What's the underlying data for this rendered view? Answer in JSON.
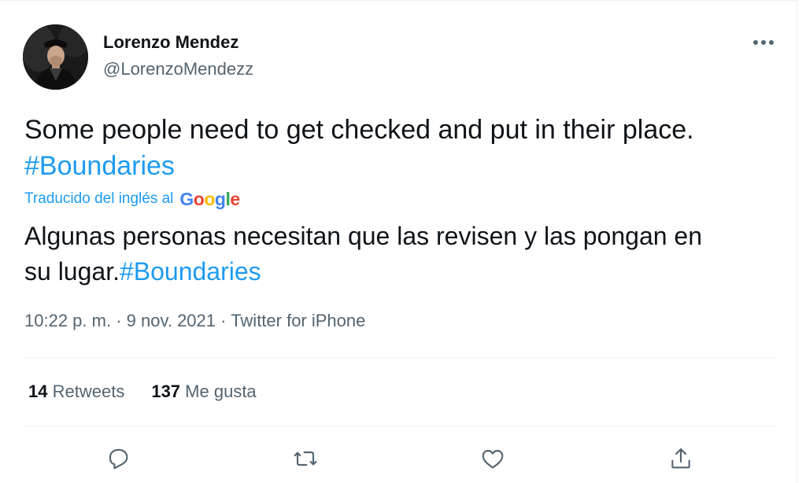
{
  "author": {
    "display_name": "Lorenzo Mendez",
    "handle": "@LorenzoMendezz"
  },
  "tweet": {
    "text_main": "Some people need to get checked and put in their place.",
    "hashtag": "#Boundaries"
  },
  "translation": {
    "label": "Traducido del inglés al",
    "provider_letters": [
      "G",
      "o",
      "o",
      "g",
      "l",
      "e"
    ],
    "provider_colors": [
      "#4285F4",
      "#EA4335",
      "#FBBC05",
      "#4285F4",
      "#34A853",
      "#EA4335"
    ],
    "text_main": "Algunas personas necesitan que las revisen y las pongan en su lugar.",
    "hashtag": "#Boundaries"
  },
  "meta": {
    "time": "10:22 p. m.",
    "separator": "·",
    "date": "9 nov. 2021",
    "source": "Twitter for iPhone"
  },
  "stats": {
    "retweets_count": "14",
    "retweets_label": "Retweets",
    "likes_count": "137",
    "likes_label": "Me gusta"
  },
  "icons": {
    "more": "more-dots-icon",
    "reply": "reply-icon",
    "retweet": "retweet-icon",
    "like": "heart-icon",
    "share": "share-icon"
  },
  "colors": {
    "accent": "#1d9bf0",
    "text_primary": "#0f1419",
    "text_secondary": "#536471",
    "divider": "#eff3f4"
  }
}
